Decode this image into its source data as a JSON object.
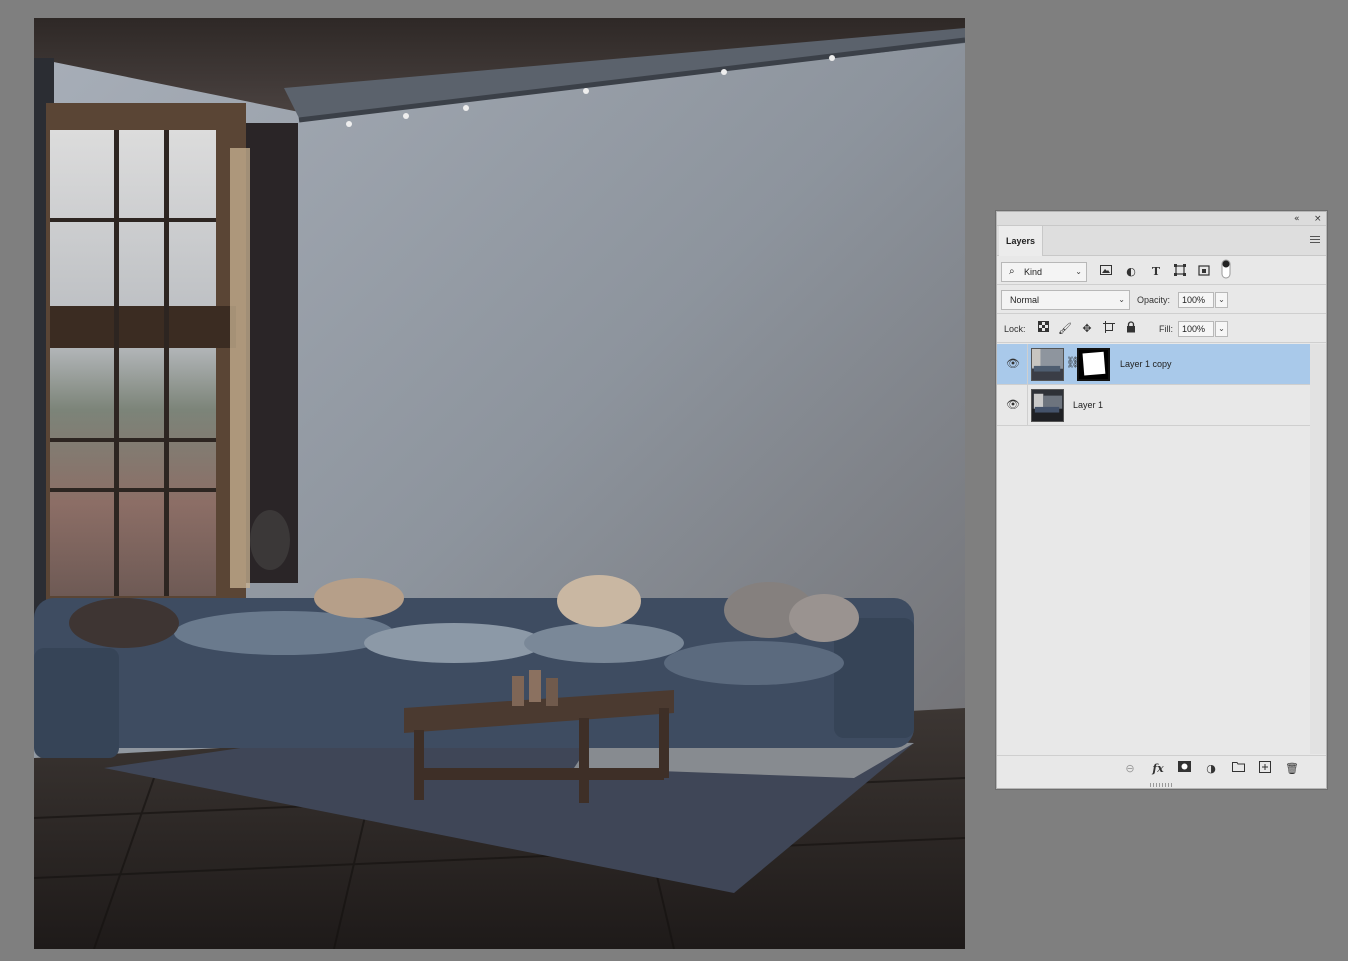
{
  "canvas": {
    "alt": "Living room interior with large grey wall, window, blue sectional sofa, wooden coffee table and rug"
  },
  "panel": {
    "collapse_icon": "double-chevron-left-icon",
    "close_icon": "close-icon",
    "tab_label": "Layers",
    "menu_icon": "hamburger-icon",
    "filter": {
      "kind_label": "Kind",
      "icons": [
        "image-filter-icon",
        "adjustment-filter-icon",
        "type-filter-icon",
        "shape-filter-icon",
        "smart-object-filter-icon",
        "filter-toggle-icon"
      ]
    },
    "blend": {
      "mode": "Normal",
      "opacity_label": "Opacity:",
      "opacity_value": "100%"
    },
    "lock": {
      "label": "Lock:",
      "icons": [
        "lock-transparent-icon",
        "lock-image-icon",
        "lock-position-icon",
        "lock-artboard-icon",
        "lock-all-icon"
      ],
      "fill_label": "Fill:",
      "fill_value": "100%"
    },
    "layers": [
      {
        "name": "Layer 1 copy",
        "visible": true,
        "selected": true,
        "has_mask": true
      },
      {
        "name": "Layer 1",
        "visible": true,
        "selected": false,
        "has_mask": false
      }
    ],
    "footer_icons": [
      "link-layers-icon",
      "fx-icon",
      "add-mask-icon",
      "adjustment-layer-icon",
      "new-group-icon",
      "new-layer-icon",
      "delete-icon"
    ],
    "footer_fx": "fx"
  },
  "colors": {
    "selection": "#a9c9ea",
    "panel_bg": "#e8e8e8",
    "workspace_bg": "#7f7f7f"
  }
}
